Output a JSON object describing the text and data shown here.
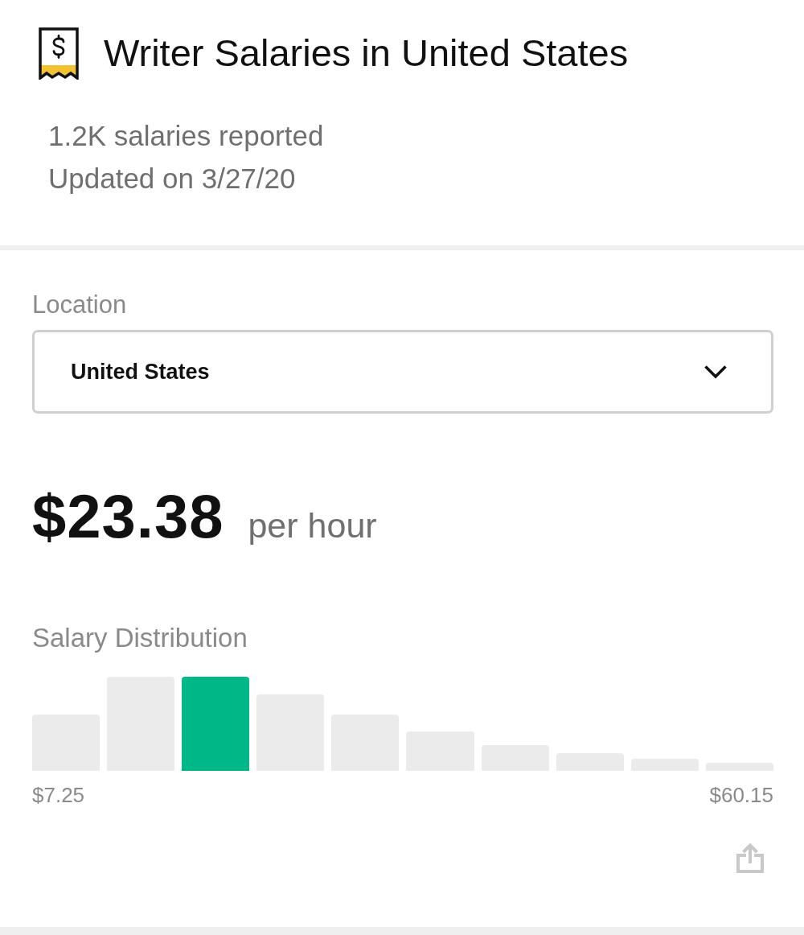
{
  "header": {
    "title": "Writer Salaries in United States",
    "salaries_reported": "1.2K salaries reported",
    "updated": "Updated on 3/27/20"
  },
  "location": {
    "label": "Location",
    "value": "United States"
  },
  "pay": {
    "amount": "$23.38",
    "unit": "per hour"
  },
  "distribution": {
    "title": "Salary Distribution",
    "bars": [
      {
        "selected": false
      },
      {
        "selected": false
      },
      {
        "selected": true
      },
      {
        "selected": false
      },
      {
        "selected": false
      },
      {
        "selected": false
      },
      {
        "selected": false
      },
      {
        "selected": false
      },
      {
        "selected": false
      },
      {
        "selected": false
      }
    ],
    "min_label": "$7.25",
    "max_label": "$60.15"
  }
}
